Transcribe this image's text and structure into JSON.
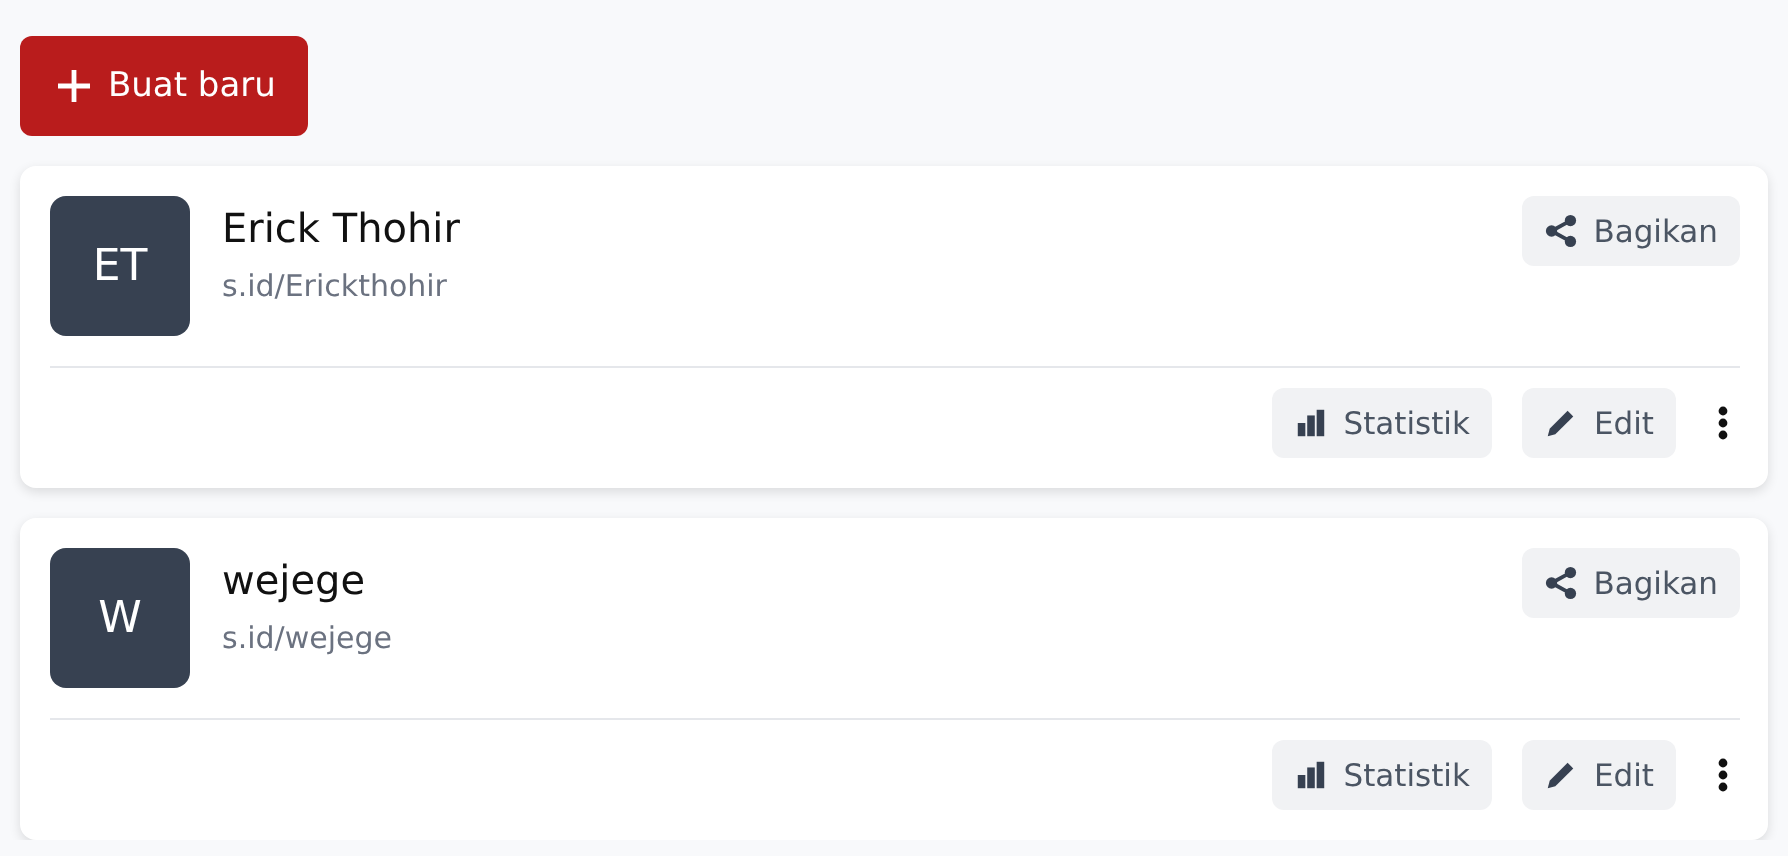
{
  "create_button": {
    "label": "Buat baru"
  },
  "links": [
    {
      "initials": "ET",
      "name": "Erick Thohir",
      "url": "s.id/Erickthohir",
      "share_label": "Bagikan",
      "stats_label": "Statistik",
      "edit_label": "Edit"
    },
    {
      "initials": "W",
      "name": "wejege",
      "url": "s.id/wejege",
      "share_label": "Bagikan",
      "stats_label": "Statistik",
      "edit_label": "Edit"
    }
  ]
}
